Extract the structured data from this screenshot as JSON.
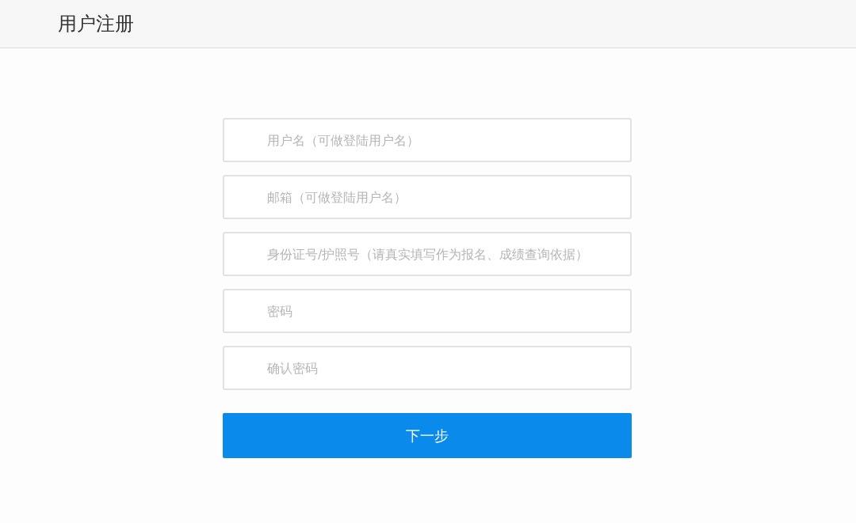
{
  "header": {
    "title": "用户注册"
  },
  "fields": [
    {
      "placeholder": "用户名（可做登陆用户名）"
    },
    {
      "placeholder": "邮箱（可做登陆用户名）"
    },
    {
      "placeholder": "身份证号/护照号（请真实填写作为报名、成绩查询依据）"
    },
    {
      "placeholder": "密码"
    },
    {
      "placeholder": "确认密码"
    }
  ],
  "submit_button": {
    "label": "下一步"
  }
}
